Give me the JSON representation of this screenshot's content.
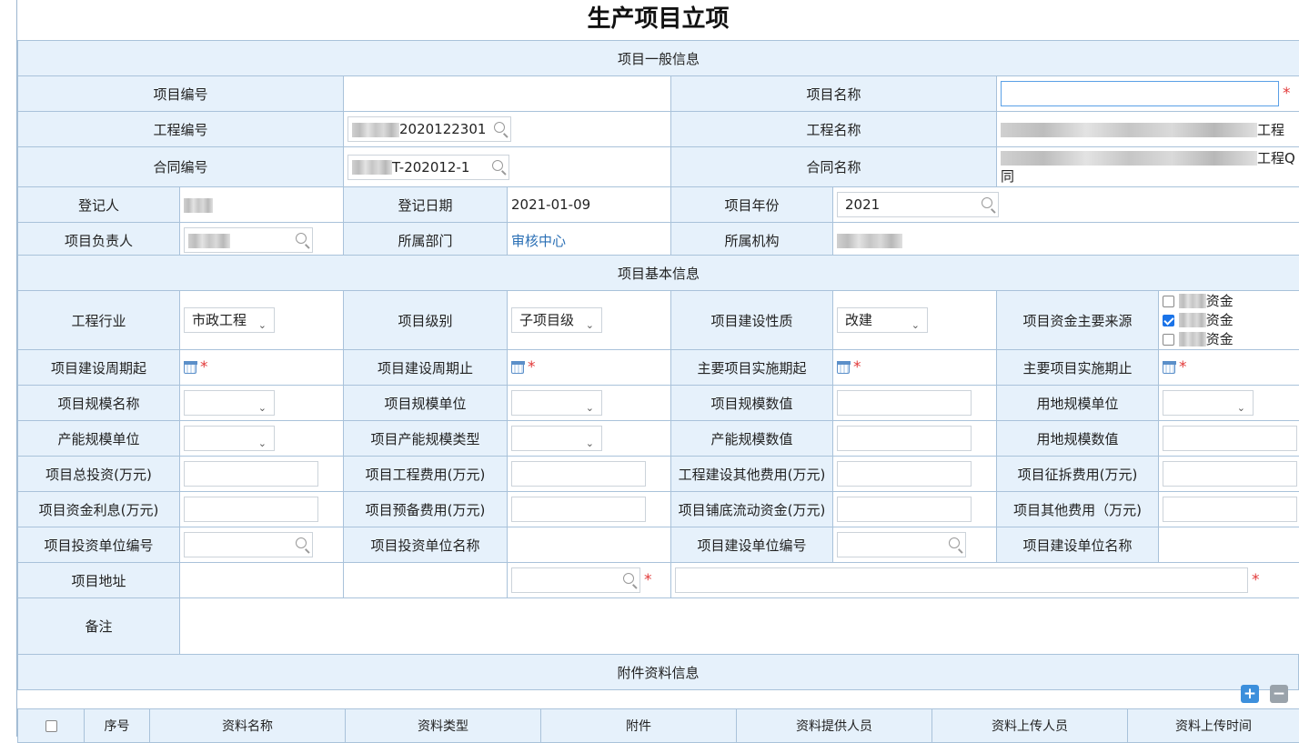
{
  "title": "生产项目立项",
  "sections": {
    "general": "项目一般信息",
    "basic": "项目基本信息",
    "attach": "附件资料信息"
  },
  "general": {
    "project_no_label": "项目编号",
    "project_name_label": "项目名称",
    "project_name_value": "",
    "eng_no_label": "工程编号",
    "eng_no_value": "2020122301",
    "eng_name_label": "工程名称",
    "eng_name_suffix": "工程",
    "contract_no_label": "合同编号",
    "contract_no_value": "T-202012-1",
    "contract_name_label": "合同名称",
    "contract_name_suffix": "工程Q",
    "contract_name_line2": "同",
    "registrant_label": "登记人",
    "reg_date_label": "登记日期",
    "reg_date_value": "2021-01-09",
    "project_year_label": "项目年份",
    "project_year_value": "2021",
    "leader_label": "项目负责人",
    "dept_label": "所属部门",
    "dept_value": "审核中心",
    "org_label": "所属机构"
  },
  "basic": {
    "industry_label": "工程行业",
    "industry_value": "市政工程",
    "level_label": "项目级别",
    "level_value": "子项目级",
    "nature_label": "项目建设性质",
    "nature_value": "改建",
    "fund_label": "项目资金主要来源",
    "fund_options": [
      {
        "text": "资金",
        "checked": false
      },
      {
        "text": "资金",
        "checked": true
      },
      {
        "text": "资金",
        "checked": false
      }
    ],
    "build_start_label": "项目建设周期起",
    "build_end_label": "项目建设周期止",
    "impl_start_label": "主要项目实施期起",
    "impl_end_label": "主要项目实施期止",
    "scale_name_label": "项目规模名称",
    "scale_unit_label": "项目规模单位",
    "scale_value_label": "项目规模数值",
    "land_unit_label": "用地规模单位",
    "cap_unit_label": "产能规模单位",
    "cap_type_label": "项目产能规模类型",
    "cap_value_label": "产能规模数值",
    "land_value_label": "用地规模数值",
    "total_invest_label": "项目总投资(万元)",
    "eng_cost_label": "项目工程费用(万元)",
    "other_cost_label": "工程建设其他费用(万元)",
    "demolish_label": "项目征拆费用(万元)",
    "interest_label": "项目资金利息(万元)",
    "reserve_label": "项目预备费用(万元)",
    "working_cap_label": "项目铺底流动资金(万元)",
    "misc_cost_label": "项目其他费用（万元)",
    "invest_unit_no_label": "项目投资单位编号",
    "invest_unit_name_label": "项目投资单位名称",
    "build_unit_no_label": "项目建设单位编号",
    "build_unit_name_label": "项目建设单位名称",
    "address_label": "项目地址",
    "remark_label": "备注"
  },
  "attach_table": {
    "columns": [
      "序号",
      "资料名称",
      "资料类型",
      "附件",
      "资料提供人员",
      "资料上传人员",
      "资料上传时间"
    ]
  },
  "buttons": {
    "add": "+",
    "remove": "−"
  },
  "colors": {
    "section_bg": "#e6f1fb",
    "border": "#a9c2da",
    "required": "#e23a3a",
    "add_btn": "#3c8fdc",
    "remove_btn": "#9aa3ab"
  }
}
